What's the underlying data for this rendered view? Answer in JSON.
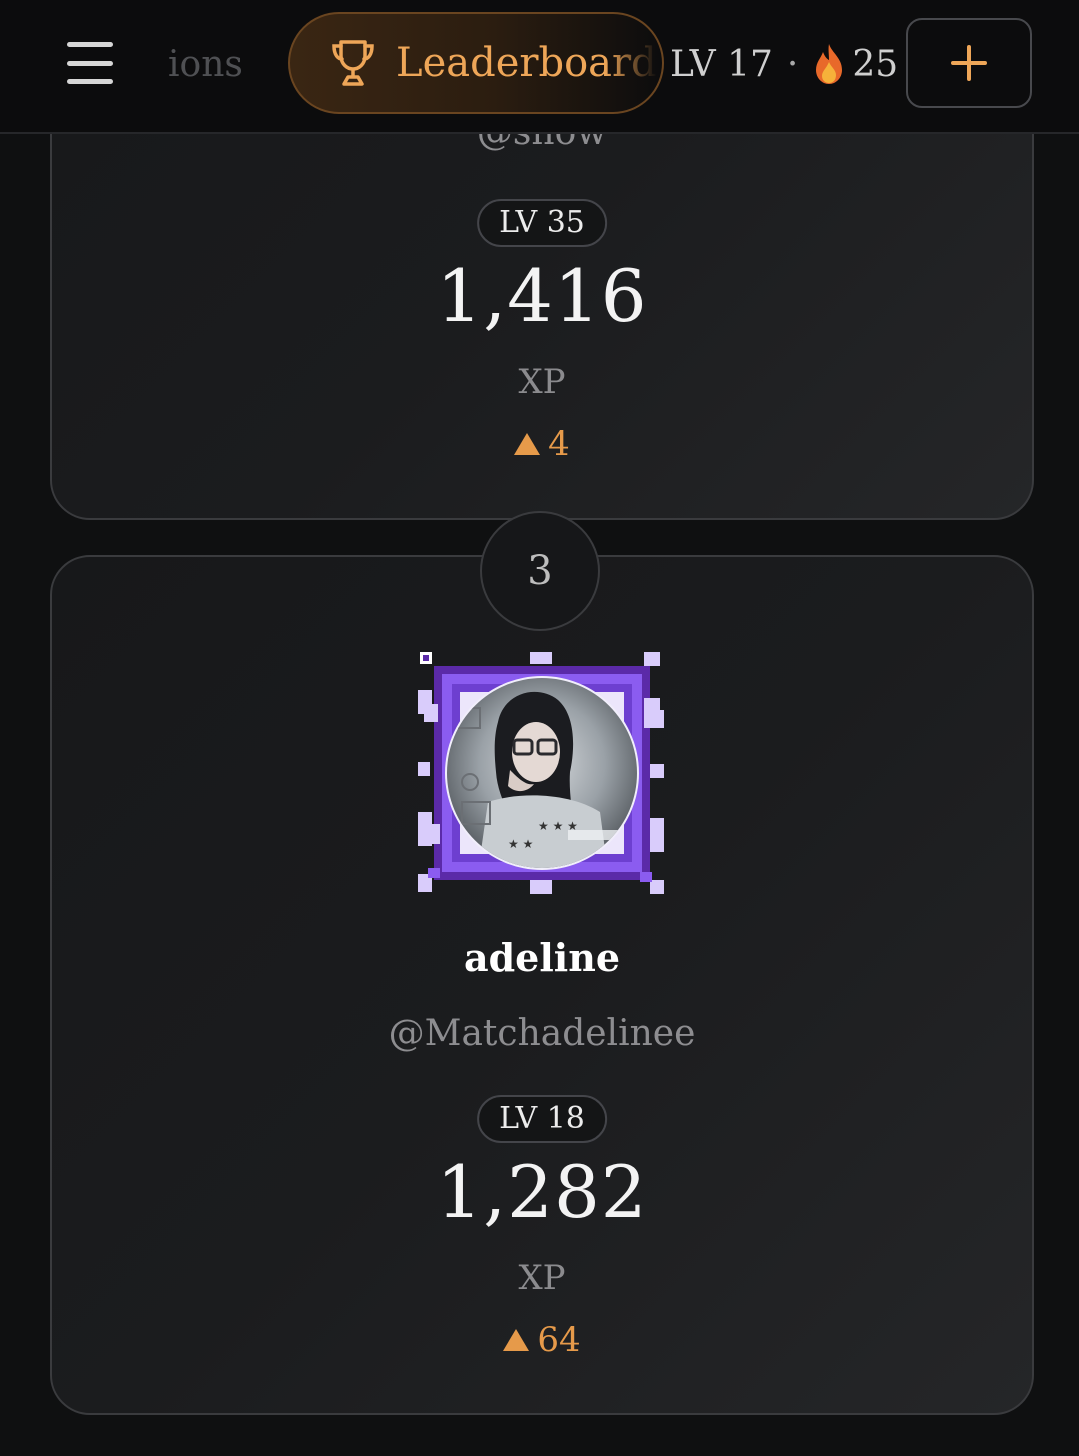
{
  "topbar": {
    "partial_tab_label": "ions",
    "active_tab_label": "Leaderboard",
    "level_label": "LV 17",
    "separator": "·",
    "streak_count": "25",
    "add_label": "+"
  },
  "entries": [
    {
      "handle": "@snow",
      "level": "LV 35",
      "xp": "1,416",
      "xp_unit": "XP",
      "delta": "4"
    },
    {
      "rank": "3",
      "name": "adeline",
      "handle": "@Matchadelinee",
      "level": "LV 18",
      "xp": "1,282",
      "xp_unit": "XP",
      "delta": "64"
    }
  ],
  "colors": {
    "accent": "#eea658",
    "delta": "#e69a4a",
    "frame_purple": "#6a35c4"
  }
}
